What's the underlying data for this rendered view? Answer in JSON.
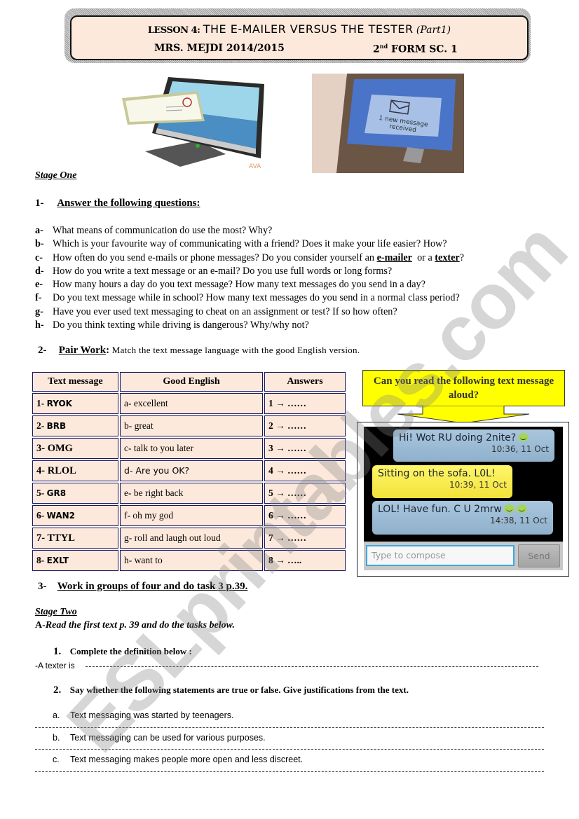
{
  "header": {
    "lesson_label": "LESSON 4:",
    "title": "THE E-MAILER VERSUS THE TESTER",
    "part": "(Part1)",
    "teacher": "MRS. MEJDI 2014/2015",
    "class_num": "2",
    "class_sup": "nd",
    "class_rest": "FORM SC. 1"
  },
  "images": {
    "computer_alt": "computer monitor with envelope",
    "phone_screen_text": "1 new message received",
    "logo": "AVA"
  },
  "stage_one": {
    "label": "Stage One",
    "q1": {
      "number": "1-",
      "title": "Answer the following questions:",
      "items": [
        {
          "label": "a-",
          "text": "What means of communication do use the most? Why?"
        },
        {
          "label": "b-",
          "text": "Which is your favourite way of communicating with a friend? Does it make your life easier? How?"
        },
        {
          "label": "c-",
          "text_before": "How often do you send e-mails or phone messages? Do you consider yourself an ",
          "bold1": "e-mailer",
          "mid": "  or a ",
          "bold2": "texter",
          "after": "?"
        },
        {
          "label": "d-",
          "text": "How do you write a text message or an e-mail? Do you use full words or long forms?"
        },
        {
          "label": "e-",
          "text": "How many hours a day do you text message?  How many text messages do you send in a day?"
        },
        {
          "label": "f-",
          "text": "Do you text message while in school?  How many text messages do you send in a normal class period?"
        },
        {
          "label": "g-",
          "text": "Have you ever used text messaging to cheat on an assignment or test?  If so how often?"
        },
        {
          "label": "h-",
          "text": "Do you think texting while driving is dangerous?  Why/why not?"
        }
      ]
    },
    "q2": {
      "number": "2-",
      "title": "Pair Work",
      "colon": ":",
      "instruction": "Match the text  message language with the good English version.",
      "table": {
        "headers": [
          "Text message",
          "Good English",
          "Answers"
        ],
        "rows": [
          {
            "num": "1- ",
            "abbr": "RYOK",
            "english": "a- excellent",
            "answer": "1 → ……"
          },
          {
            "num": "2- ",
            "abbr": "BRB",
            "english": "b- great",
            "answer": "2 → ……"
          },
          {
            "num": "3- ",
            "abbr": "OMG",
            "english": "c- talk to you later",
            "answer": "3 → ……"
          },
          {
            "num": "4- ",
            "abbr": "RLOL",
            "english": "d- Are you OK?",
            "answer": "4 → ……"
          },
          {
            "num": "5- ",
            "abbr": "GR8",
            "english": "e- be right back",
            "answer": "5 → ……"
          },
          {
            "num": "6- ",
            "abbr": "WAN2",
            "english": "f- oh my god",
            "answer": "6 → ……"
          },
          {
            "num": "7- ",
            "abbr": "TTYL",
            "english": "g- roll and laugh out loud",
            "answer": "7 → ……"
          },
          {
            "num": "8- ",
            "abbr": "EXLT",
            "english": "h- want to",
            "answer": "8 → ….."
          }
        ]
      }
    },
    "callout": "Can you read the following text message aloud?",
    "chat": {
      "messages": [
        {
          "text": "Hi! Wot RU doing 2nite?",
          "time": "10:36, 11 Oct",
          "color": "#a9c6de"
        },
        {
          "text": "Sitting on the sofa. L0L!",
          "time": "10:39, 11 Oct",
          "color": "#fff66a"
        },
        {
          "text": "LOL! Have fun. C U 2mrw",
          "time": "14:38, 11 Oct",
          "color": "#a9c6de"
        }
      ],
      "compose_placeholder": "Type to compose",
      "send_label": "Send"
    },
    "q3": {
      "number": "3-",
      "title": "Work in groups of four and do task 3 p.39."
    }
  },
  "stage_two": {
    "label": "Stage Two",
    "instruction_prefix": "A-",
    "instruction": "Read the first text p. 39 and do the tasks below.",
    "task1": {
      "number": "1.",
      "title": "Complete the definition below :",
      "prompt": "-A texter is"
    },
    "task2": {
      "number": "2.",
      "title": "Say whether the following statements are true or false. Give justifications from the text.",
      "statements": [
        {
          "label": "a.",
          "text": "Text messaging was started by teenagers."
        },
        {
          "label": "b.",
          "text": "Text messaging can be used for various purposes."
        },
        {
          "label": "c.",
          "text": "Text messaging makes people more open and less discreet."
        }
      ]
    }
  },
  "watermark": "ESLprintables.com"
}
